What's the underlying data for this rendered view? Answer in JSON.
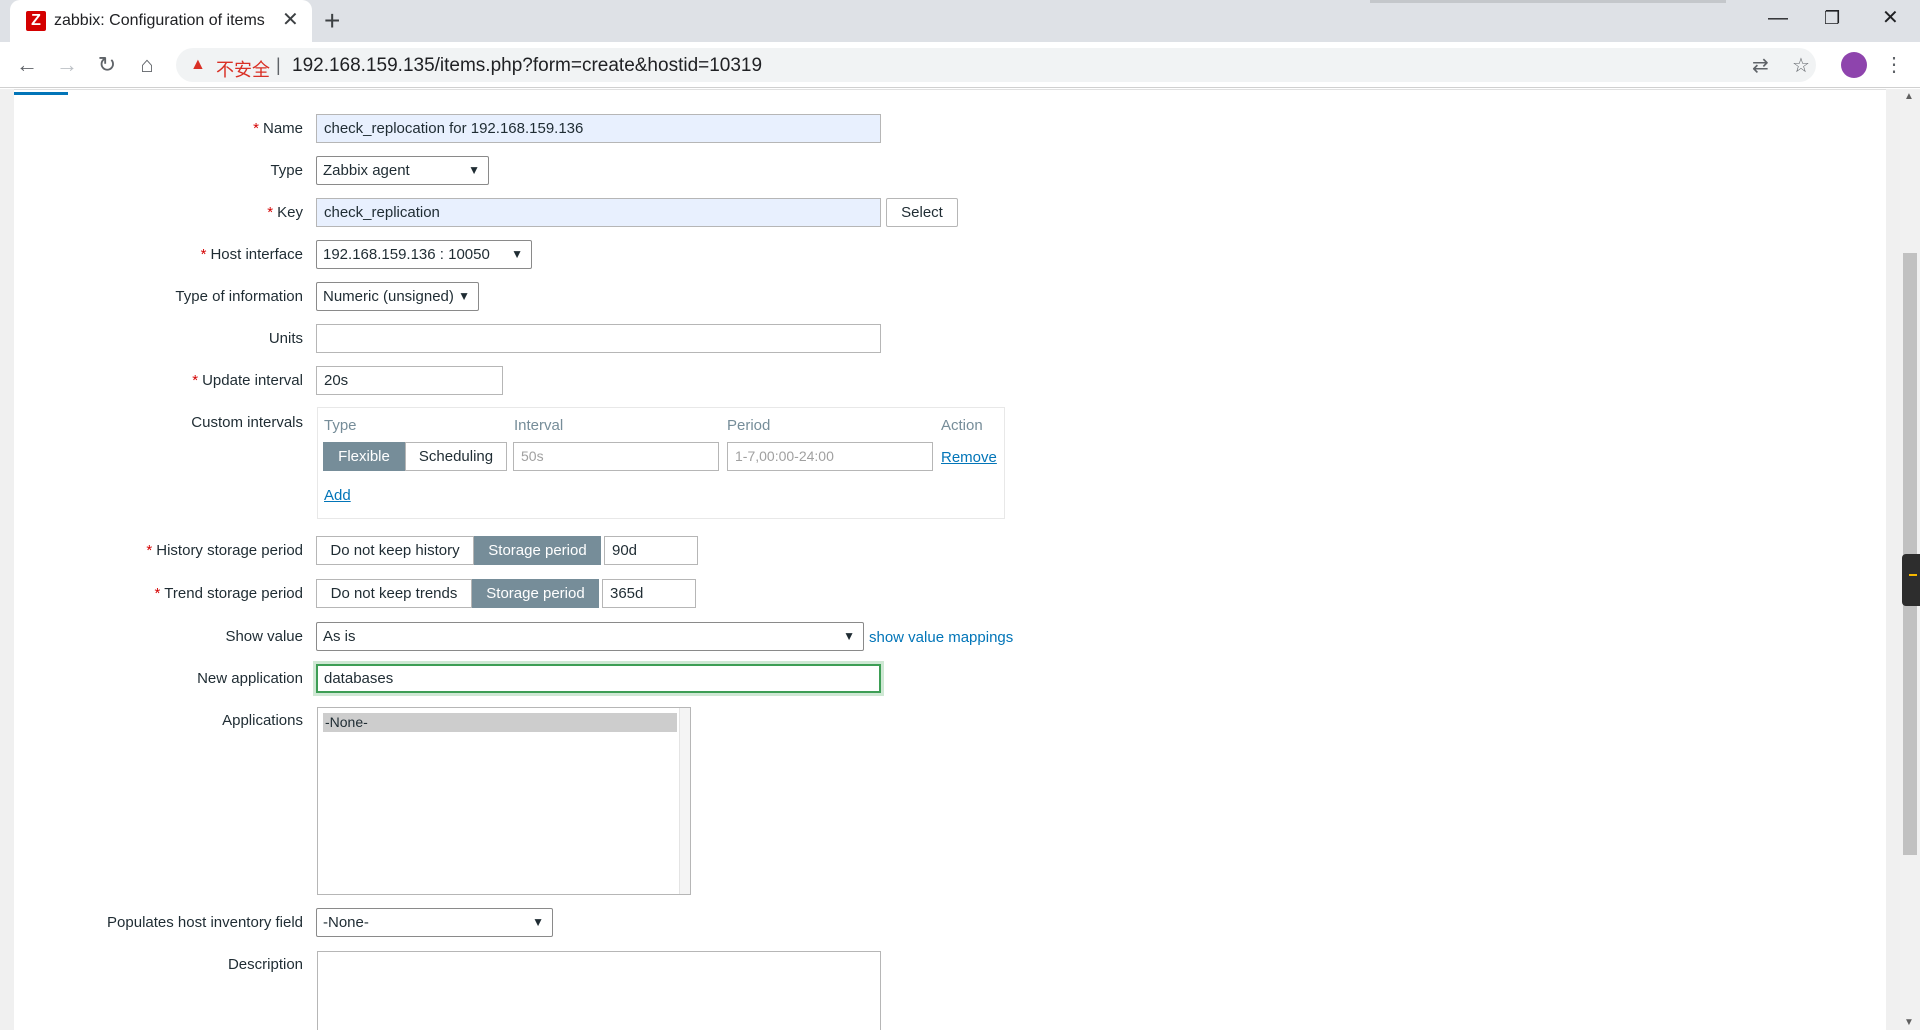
{
  "browser": {
    "tab_title": "zabbix: Configuration of items",
    "favicon_letter": "Z",
    "tab_close": "✕",
    "new_tab": "+",
    "not_secure": "不安全",
    "separator": "|",
    "url": "192.168.159.135/items.php?form=create&hostid=10319",
    "window_controls": {
      "minimize": "—",
      "restore": "❐",
      "close": "✕"
    }
  },
  "form": {
    "required_mark": "*",
    "name": {
      "label": "Name",
      "value": "check_replocation for 192.168.159.136"
    },
    "type": {
      "label": "Type",
      "value": "Zabbix agent"
    },
    "key": {
      "label": "Key",
      "value": "check_replication",
      "select_button": "Select"
    },
    "host_interface": {
      "label": "Host interface",
      "value": "192.168.159.136 : 10050"
    },
    "type_of_information": {
      "label": "Type of information",
      "value": "Numeric (unsigned)"
    },
    "units": {
      "label": "Units",
      "value": ""
    },
    "update_interval": {
      "label": "Update interval",
      "value": "20s"
    },
    "custom_intervals": {
      "label": "Custom intervals",
      "headers": {
        "type": "Type",
        "interval": "Interval",
        "period": "Period",
        "action": "Action"
      },
      "row": {
        "type_options": [
          "Flexible",
          "Scheduling"
        ],
        "selected_type": "Flexible",
        "interval_placeholder": "50s",
        "period_placeholder": "1-7,00:00-24:00",
        "remove": "Remove"
      },
      "add": "Add"
    },
    "history_storage": {
      "label": "History storage period",
      "options": [
        "Do not keep history",
        "Storage period"
      ],
      "selected": "Storage period",
      "value": "90d"
    },
    "trend_storage": {
      "label": "Trend storage period",
      "options": [
        "Do not keep trends",
        "Storage period"
      ],
      "selected": "Storage period",
      "value": "365d"
    },
    "show_value": {
      "label": "Show value",
      "value": "As is",
      "mappings_link": "show value mappings"
    },
    "new_application": {
      "label": "New application",
      "value": "databases"
    },
    "applications": {
      "label": "Applications",
      "options": [
        "-None-"
      ],
      "selected": "-None-"
    },
    "inventory_field": {
      "label": "Populates host inventory field",
      "value": "-None-"
    },
    "description": {
      "label": "Description",
      "value": ""
    }
  },
  "colors": {
    "accent": "#0275b8",
    "required": "#d40000",
    "segment_active": "#768d99",
    "focus_border": "#3d9e55"
  },
  "icons": [
    "back-arrow-icon",
    "forward-arrow-icon",
    "reload-icon",
    "home-icon",
    "warning-icon",
    "translate-icon",
    "star-icon",
    "profile-avatar-icon",
    "menu-dots-icon",
    "chevron-down-icon"
  ]
}
